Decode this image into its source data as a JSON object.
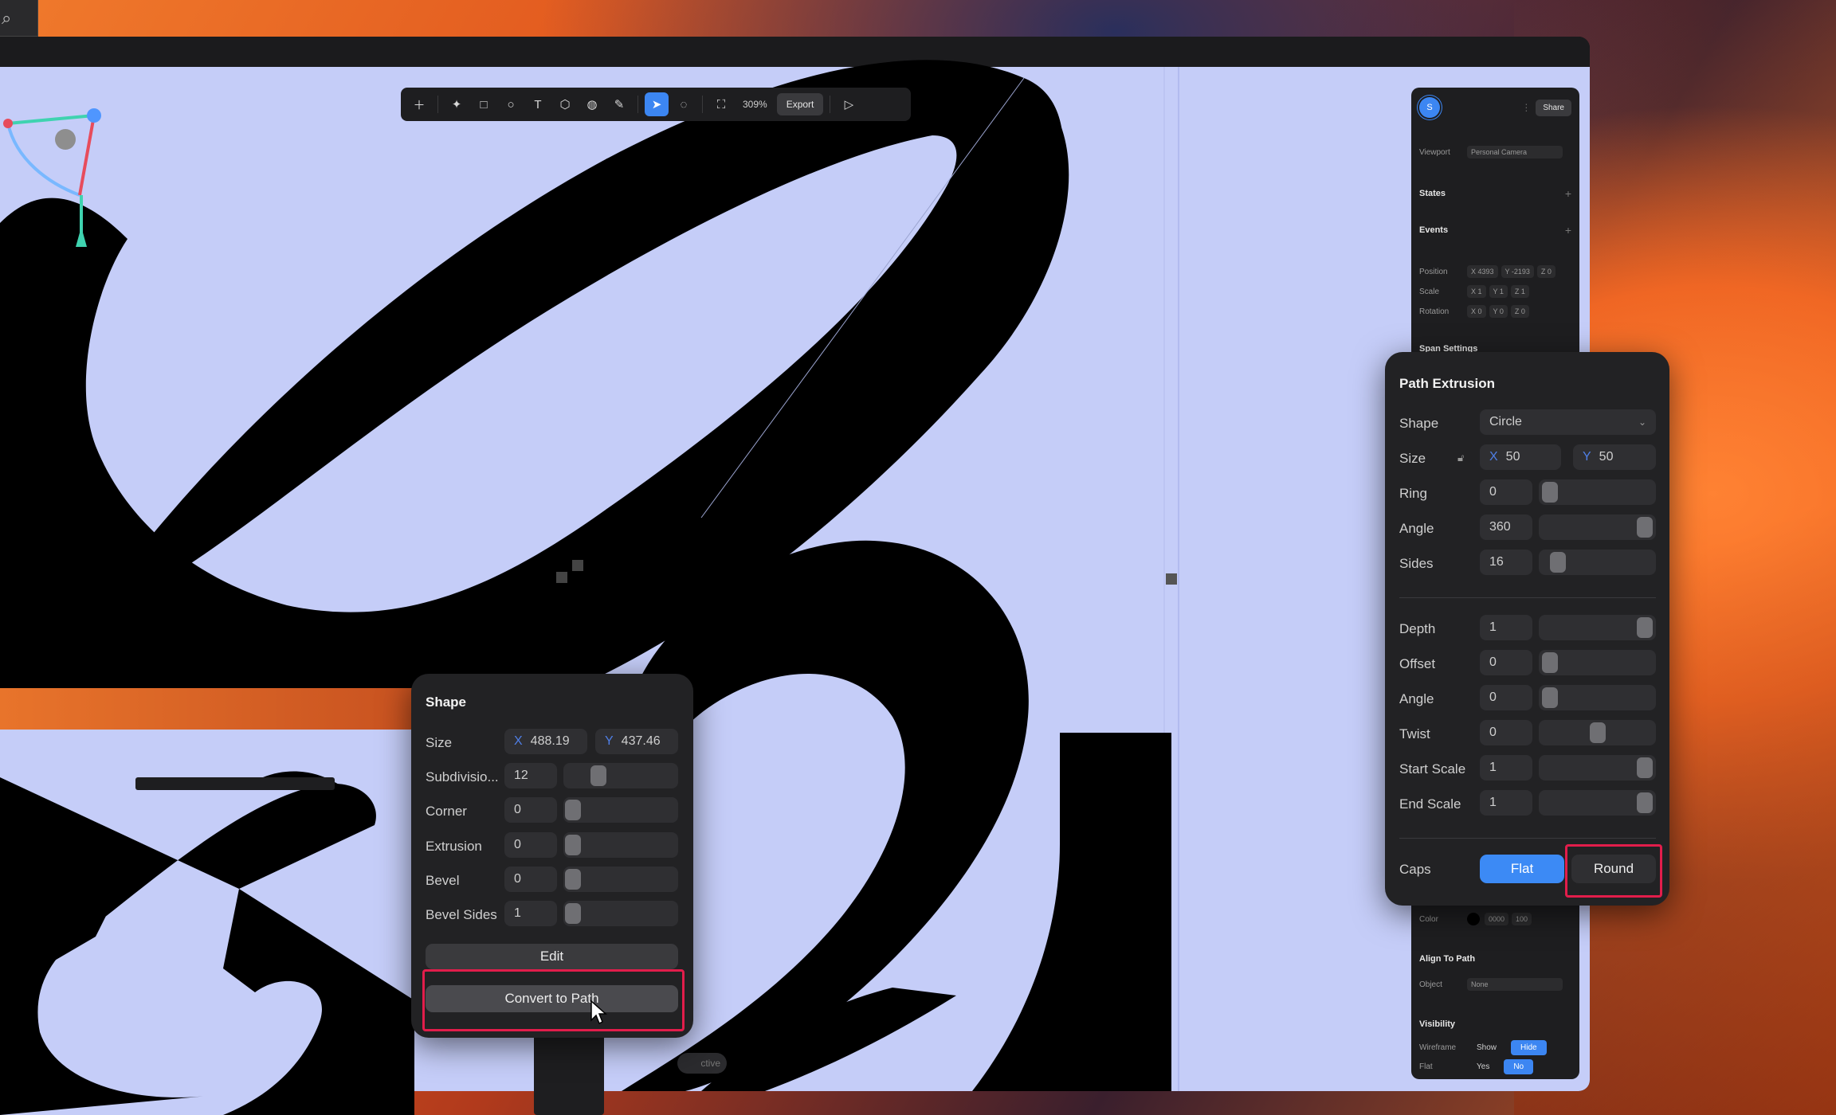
{
  "toolbar": {
    "zoom": "309%",
    "export_label": "Export"
  },
  "right_panel": {
    "avatar_initial": "S",
    "share_label": "Share",
    "viewport_label": "Viewport",
    "viewport_value": "Personal Camera",
    "states_label": "States",
    "events_label": "Events",
    "position_label": "Position",
    "position_x": "X 4393",
    "position_y": "Y -2193",
    "position_z": "Z 0",
    "scale_label": "Scale",
    "scale_x": "X 1",
    "scale_y": "Y 1",
    "scale_z": "Z 1",
    "rotation_label": "Rotation",
    "rotation_x": "X 0",
    "rotation_y": "Y 0",
    "rotation_z": "Z 0",
    "span_settings_label": "Span Settings",
    "color_label": "Color",
    "color_hex": "0000",
    "color_opacity": "100",
    "align_to_path_label": "Align To Path",
    "object_label": "Object",
    "object_value": "None",
    "visibility_label": "Visibility",
    "wireframe_label": "Wireframe",
    "wireframe_show": "Show",
    "wireframe_hide": "Hide",
    "flat_label": "Flat",
    "flat_yes": "Yes",
    "flat_no": "No"
  },
  "path_extrusion": {
    "title": "Path Extrusion",
    "shape_label": "Shape",
    "shape_value": "Circle",
    "size_label": "Size",
    "size_x": "50",
    "size_y": "50",
    "ring_label": "Ring",
    "ring_value": "0",
    "angle_label": "Angle",
    "angle_value": "360",
    "sides_label": "Sides",
    "sides_value": "16",
    "depth_label": "Depth",
    "depth_value": "1",
    "offset_label": "Offset",
    "offset_value": "0",
    "angle2_label": "Angle",
    "angle2_value": "0",
    "twist_label": "Twist",
    "twist_value": "0",
    "start_scale_label": "Start Scale",
    "start_scale_value": "1",
    "end_scale_label": "End Scale",
    "end_scale_value": "1",
    "caps_label": "Caps",
    "caps_flat": "Flat",
    "caps_round": "Round"
  },
  "shape_panel": {
    "title": "Shape",
    "size_label": "Size",
    "size_x": "488.19",
    "size_y": "437.46",
    "subdivisions_label": "Subdivisio...",
    "subdivisions_value": "12",
    "corner_label": "Corner",
    "corner_value": "0",
    "extrusion_label": "Extrusion",
    "extrusion_value": "0",
    "bevel_label": "Bevel",
    "bevel_value": "0",
    "bevel_sides_label": "Bevel Sides",
    "bevel_sides_value": "1",
    "edit_label": "Edit",
    "convert_label": "Convert to Path"
  },
  "inactive_pill": "ctive",
  "colors": {
    "accent": "#3c86f2",
    "highlight": "#e21d4b",
    "canvas": "#c5cdf8",
    "panel": "#222224"
  }
}
